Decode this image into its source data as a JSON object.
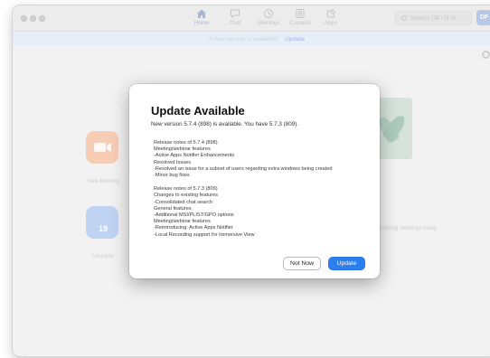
{
  "toolbar": {
    "nav": [
      {
        "label": "Home",
        "icon": "home-icon"
      },
      {
        "label": "Chat",
        "icon": "chat-icon"
      },
      {
        "label": "Meetings",
        "icon": "clock-icon"
      },
      {
        "label": "Contacts",
        "icon": "contacts-icon"
      },
      {
        "label": "Apps",
        "icon": "apps-icon"
      }
    ],
    "search_placeholder": "Search (⌘+J) to",
    "avatar_initials": "DF"
  },
  "banner": {
    "message": "A new version is available!",
    "link": "Update"
  },
  "background": {
    "tile_labels": [
      "New Meeting",
      "Schedule",
      "No upcoming meetings today"
    ],
    "calendar_day": "19"
  },
  "modal": {
    "title": "Update Available",
    "subtitle": "New version 5.7.4 (898) is available. You have 5.7.3 (809).",
    "release_notes": [
      [
        "Release notes of 5.7.4 (898)",
        "Meeting/webinar features",
        "-Active Apps Notifier Enhancements",
        "Resolved Issues",
        "-Resolved an issue for a subset of users regarding extra windows being created",
        "-Minor bug fixes"
      ],
      [
        "Release notes of 5.7.3 (809)",
        "Changes to existing features",
        "-Consolidated chat search",
        "General features",
        "-Additional MSI/PLIST/GPO options",
        "Meeting/webinar features",
        "-Reintroducing: Active Apps Notifier",
        "-Local Recording support for Immersive View"
      ]
    ],
    "buttons": {
      "not_now": "Not Now",
      "update": "Update"
    }
  },
  "colors": {
    "accent": "#2d7ff0",
    "banner_bg": "#e8eef7",
    "orange_tile": "#f7cdb6",
    "blue_tile": "#c1d3f2"
  }
}
